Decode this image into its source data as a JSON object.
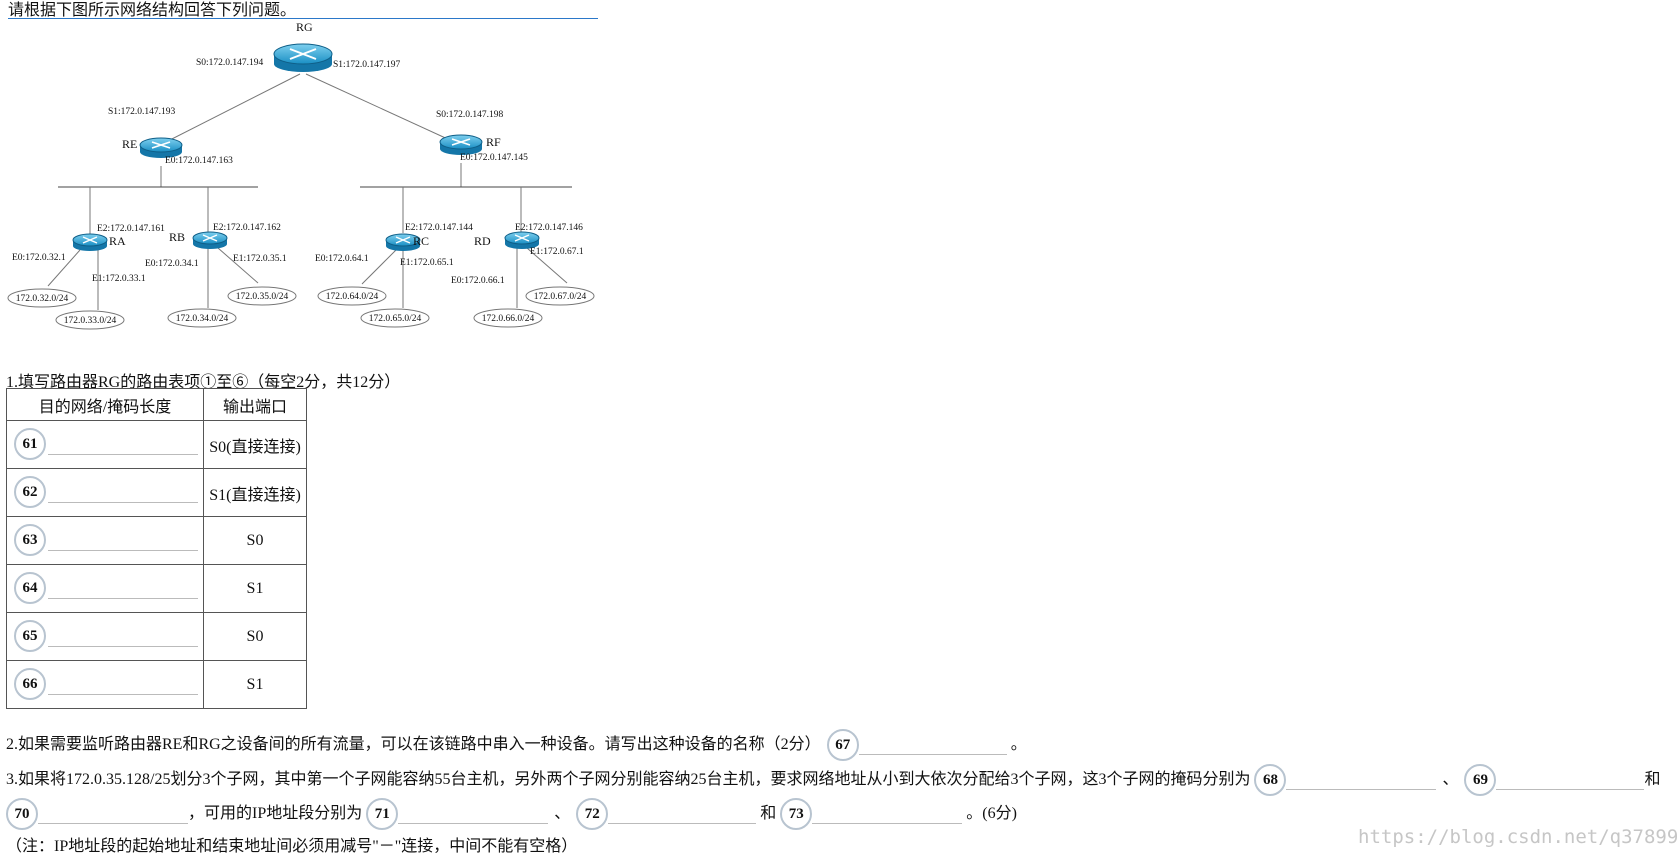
{
  "header": {
    "text": "请根据下图所示网络结构回答下列问题。"
  },
  "diagram": {
    "routers": {
      "rg": "RG",
      "re": "RE",
      "rf": "RF",
      "ra": "RA",
      "rb": "RB",
      "rc": "RC",
      "rd": "RD"
    },
    "labels": {
      "rg_s0": "S0:172.0.147.194",
      "rg_s1": "S1:172.0.147.197",
      "re_s1": "S1:172.0.147.193",
      "rf_s0": "S0:172.0.147.198",
      "re_e0": "E0:172.0.147.163",
      "rf_e0": "E0:172.0.147.145",
      "ra_e2": "E2:172.0.147.161",
      "rb_e2": "E2:172.0.147.162",
      "rc_e2": "E2:172.0.147.144",
      "rd_e2": "E2:172.0.147.146",
      "ra_e0": "E0:172.0.32.1",
      "ra_e1": "E1:172.0.33.1",
      "rb_e0": "E0:172.0.34.1",
      "rb_e1": "E1:172.0.35.1",
      "rc_e0": "E0:172.0.64.1",
      "rc_e1": "E1:172.0.65.1",
      "rd_e0": "E0:172.0.66.1",
      "rd_e1": "E1:172.0.67.1"
    },
    "networks": {
      "n32": "172.0.32.0/24",
      "n33": "172.0.33.0/24",
      "n34": "172.0.34.0/24",
      "n35": "172.0.35.0/24",
      "n64": "172.0.64.0/24",
      "n65": "172.0.65.0/24",
      "n66": "172.0.66.0/24",
      "n67": "172.0.67.0/24"
    }
  },
  "q1": {
    "title": "1.填写路由器RG的路由表项①至⑥（每空2分，共12分）",
    "headers": {
      "dest": "目的网络/掩码长度",
      "port": "输出端口"
    },
    "rows": [
      {
        "num": "61",
        "port": "S0(直接连接)"
      },
      {
        "num": "62",
        "port": "S1(直接连接)"
      },
      {
        "num": "63",
        "port": "S0"
      },
      {
        "num": "64",
        "port": "S1"
      },
      {
        "num": "65",
        "port": "S0"
      },
      {
        "num": "66",
        "port": "S1"
      }
    ]
  },
  "q2": {
    "text": "2.如果需要监听路由器RE和RG之设备间的所有流量，可以在该链路中串入一种设备。请写出这种设备的名称（2分）",
    "num": "67",
    "end": "。"
  },
  "q3": {
    "text": "3.如果将172.0.35.128/25划分3个子网，其中第一个子网能容纳55台主机，另外两个子网分别能容纳25台主机，要求网络地址从小到大依次分配给3个子网，这3个子网的掩码分别为",
    "n68": "68",
    "sep1": "、",
    "n69": "69",
    "and1": "和",
    "n70": "70",
    "mid": "，可用的IP地址段分别为",
    "n71": "71",
    "sep2": "、",
    "n72": "72",
    "and2": "和",
    "n73": "73",
    "end": "。(6分)",
    "note": "（注：IP地址段的起始地址和结束地址间必须用减号\"－\"连接，中间不能有空格）"
  },
  "watermark": "https://blog.csdn.net/q378992971"
}
